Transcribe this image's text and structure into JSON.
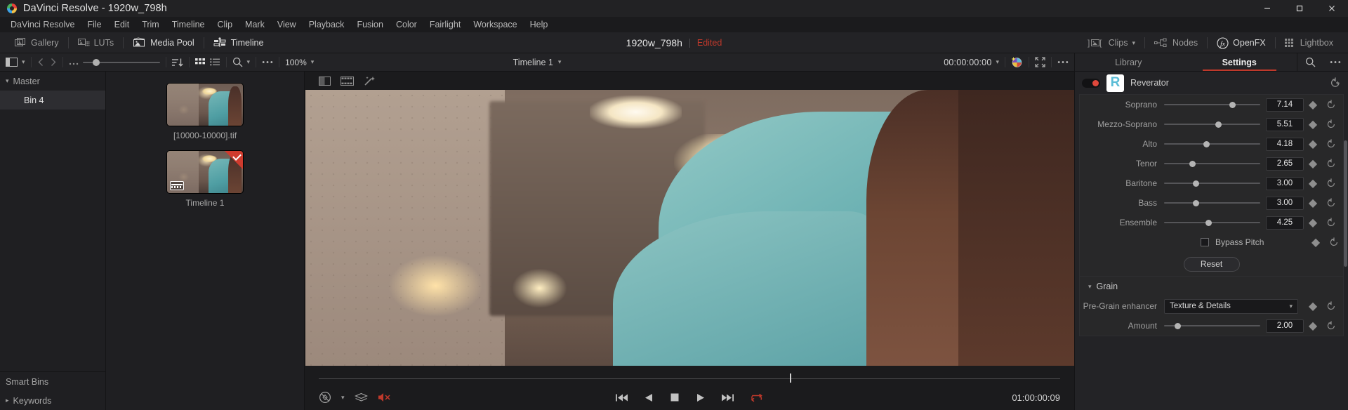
{
  "window": {
    "title": "DaVinci Resolve - 1920w_798h",
    "logo_icon": "resolve-logo-icon",
    "minimize_icon": "minimize-icon",
    "maximize_icon": "maximize-icon",
    "close_icon": "close-icon"
  },
  "menubar": {
    "items": [
      "DaVinci Resolve",
      "File",
      "Edit",
      "Trim",
      "Timeline",
      "Clip",
      "Mark",
      "View",
      "Playback",
      "Fusion",
      "Color",
      "Fairlight",
      "Workspace",
      "Help"
    ]
  },
  "pagebar": {
    "left": [
      {
        "label": "Gallery",
        "icon": "gallery-icon",
        "active": false
      },
      {
        "label": "LUTs",
        "icon": "luts-icon",
        "active": false
      },
      {
        "label": "Media Pool",
        "icon": "media-pool-icon",
        "active": true
      },
      {
        "label": "Timeline",
        "icon": "timeline-icon",
        "active": true
      }
    ],
    "right": [
      {
        "label": "Clips",
        "icon": "clips-icon",
        "has_chevron": true
      },
      {
        "label": "Nodes",
        "icon": "nodes-icon",
        "has_chevron": false
      },
      {
        "label": "OpenFX",
        "icon": "openfx-icon",
        "has_chevron": false
      },
      {
        "label": "Lightbox",
        "icon": "lightbox-icon",
        "has_chevron": false
      }
    ],
    "project_name": "1920w_798h",
    "project_status": "Edited",
    "status_color": "#c0392b"
  },
  "mediapool_toolbar": {
    "sidebar_toggle_icon": "panel-toggle-icon",
    "sidebar_chevron_icon": "chevron-down-icon",
    "back_icon": "chevron-left-icon",
    "forward_icon": "chevron-right-icon",
    "more_icon": "ellipsis-icon",
    "zoom_slider_value": 18,
    "sort_icon": "sort-descending-icon",
    "grid_view_icon": "grid-view-icon",
    "list_view_icon": "list-view-icon",
    "search_icon": "search-icon",
    "search_chevron_icon": "chevron-down-icon",
    "options_icon": "ellipsis-icon",
    "zoom_label": "100%",
    "zoom_chevron_icon": "chevron-down-icon",
    "timeline_name": "Timeline 1",
    "timeline_chevron_icon": "chevron-down-icon",
    "timecode": "00:00:00:00",
    "timecode_chevron_icon": "chevron-down-icon",
    "magic_mask_icon": "color-wheel-icon",
    "fullscreen_icon": "expand-icon",
    "viewer_options_icon": "ellipsis-icon"
  },
  "bins": {
    "master": {
      "label": "Master",
      "chevron_icon": "chevron-down-icon"
    },
    "items": [
      {
        "label": "Bin 4",
        "selected": true
      }
    ],
    "smart_bins": {
      "label": "Smart Bins"
    },
    "keywords": {
      "label": "Keywords",
      "chevron_icon": "chevron-right-icon"
    }
  },
  "thumbnails": [
    {
      "caption": "[10000-10000].tif",
      "is_timeline": false
    },
    {
      "caption": "Timeline 1",
      "is_timeline": true
    }
  ],
  "viewer": {
    "top_icons": [
      "split-view-icon",
      "filmstrip-icon",
      "magic-wand-icon"
    ],
    "transport": {
      "jump_start_icon": "jump-to-start-icon",
      "reverse_icon": "play-reverse-icon",
      "stop_icon": "stop-icon",
      "play_icon": "play-icon",
      "jump_end_icon": "jump-to-end-icon",
      "loop_icon": "loop-icon"
    },
    "left_icons": [
      "bypass-icon",
      "stack-icon",
      "mute-icon"
    ],
    "bypass_chevron_icon": "chevron-down-icon",
    "timecode": "01:00:00:09"
  },
  "inspector": {
    "tabs": [
      {
        "label": "Library",
        "active": false
      },
      {
        "label": "Settings",
        "active": true
      }
    ],
    "search_icon": "search-icon",
    "options_icon": "ellipsis-icon",
    "effect": {
      "name": "Reverator",
      "enabled": true,
      "toggle_color": "#e0483c",
      "logo_glyph": "R",
      "reset_icon": "reset-keyframe-icon"
    },
    "parameters": [
      {
        "label": "Soprano",
        "value": "7.14",
        "pos": 68,
        "keyframe_icon": "keyframe-icon",
        "reset_icon": "reset-icon"
      },
      {
        "label": "Mezzo-Soprano",
        "value": "5.51",
        "pos": 53,
        "keyframe_icon": "keyframe-icon",
        "reset_icon": "reset-icon"
      },
      {
        "label": "Alto",
        "value": "4.18",
        "pos": 41,
        "keyframe_icon": "keyframe-icon",
        "reset_icon": "reset-icon"
      },
      {
        "label": "Tenor",
        "value": "2.65",
        "pos": 26,
        "keyframe_icon": "keyframe-icon",
        "reset_icon": "reset-icon"
      },
      {
        "label": "Baritone",
        "value": "3.00",
        "pos": 30,
        "keyframe_icon": "keyframe-icon",
        "reset_icon": "reset-icon"
      },
      {
        "label": "Bass",
        "value": "3.00",
        "pos": 30,
        "keyframe_icon": "keyframe-icon",
        "reset_icon": "reset-icon"
      },
      {
        "label": "Ensemble",
        "value": "4.25",
        "pos": 43,
        "keyframe_icon": "keyframe-icon",
        "reset_icon": "reset-icon"
      }
    ],
    "bypass_pitch": {
      "label": "Bypass Pitch",
      "checked": false,
      "keyframe_icon": "keyframe-icon",
      "reset_icon": "reset-icon"
    },
    "reset_button": "Reset",
    "grain_section": {
      "label": "Grain",
      "chevron_icon": "chevron-down-icon",
      "pre_grain": {
        "label": "Pre-Grain enhancer",
        "value": "Texture & Details",
        "chevron_icon": "chevron-down-icon",
        "keyframe_icon": "keyframe-icon",
        "reset_icon": "reset-icon"
      },
      "amount": {
        "label": "Amount",
        "value": "2.00",
        "pos": 11,
        "keyframe_icon": "keyframe-icon",
        "reset_icon": "reset-icon"
      }
    }
  }
}
